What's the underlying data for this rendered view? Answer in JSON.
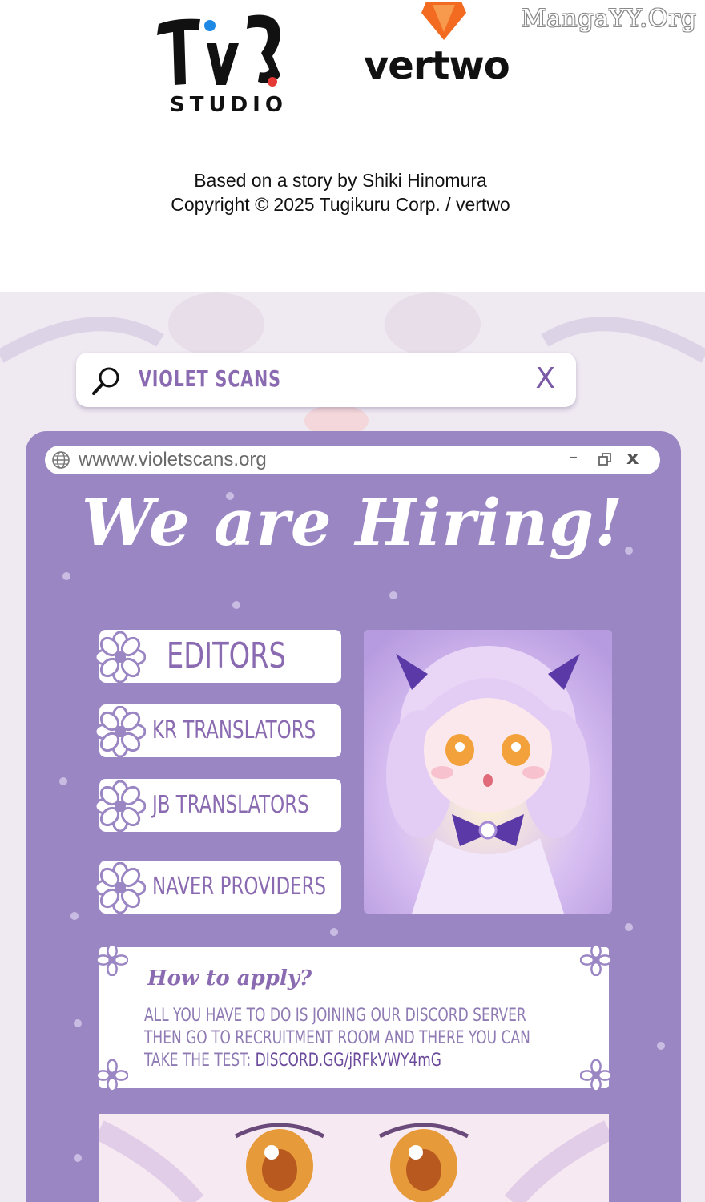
{
  "watermark": "MangaYY.Org",
  "logos": {
    "tugi_studio_label": "STUDIO"
  },
  "credits": {
    "line1": "Based on a story by Shiki Hinomura",
    "line2": "Copyright © 2025 Tugikuru Corp. / vertwo"
  },
  "search": {
    "query": "VIOLET SCANS",
    "icon": "search-icon",
    "close_label": "X"
  },
  "window": {
    "url": "wwww.violetscans.org",
    "minimize_label": "–",
    "close_label": "x"
  },
  "headline": "We are Hiring!",
  "roles": [
    {
      "label": "EDITORS"
    },
    {
      "label": "KR TRANSLATORS"
    },
    {
      "label": "JB TRANSLATORS"
    },
    {
      "label": "NAVER PROVIDERS"
    }
  ],
  "how_to_apply": {
    "title": "How to apply?",
    "line1": "ALL YOU HAVE TO DO IS JOINING OUR DISCORD SERVER",
    "line2": "THEN GO TO RECRUITMENT ROOM AND THERE YOU CAN",
    "line3_prefix": "TAKE THE TEST: ",
    "discord_link": "DISCORD.GG/jRFkVWY4mG"
  },
  "colors": {
    "panel_purple": "#9b86c4",
    "text_purple": "#8a6ab0",
    "banner_bg": "#efe9f2"
  }
}
